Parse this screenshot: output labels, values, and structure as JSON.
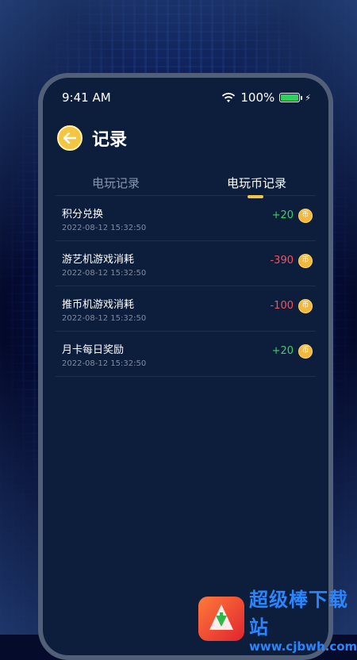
{
  "status_bar": {
    "time": "9:41 AM",
    "battery": "100%",
    "battery_level": 1.0
  },
  "header": {
    "title": "记录",
    "back_icon": "arrow-left-icon"
  },
  "tabs": [
    {
      "label": "电玩记录",
      "active": false
    },
    {
      "label": "电玩币记录",
      "active": true
    }
  ],
  "records": [
    {
      "title": "积分兑换",
      "time": "2022-08-12 15:32:50",
      "amount": "+20",
      "sign": "pos"
    },
    {
      "title": "游艺机游戏消耗",
      "time": "2022-08-12 15:32:50",
      "amount": "-390",
      "sign": "neg"
    },
    {
      "title": "推币机游戏消耗",
      "time": "2022-08-12 15:32:50",
      "amount": "-100",
      "sign": "neg"
    },
    {
      "title": "月卡每日奖励",
      "time": "2022-08-12 15:32:50",
      "amount": "+20",
      "sign": "pos"
    }
  ],
  "coin_glyph": "币",
  "watermark": {
    "name": "超级棒下载站",
    "url": "www.cjbwh.com"
  },
  "colors": {
    "accent": "#f4c542",
    "positive": "#3fcf63",
    "negative": "#ff4d5a",
    "panel": "#0d1e3d"
  }
}
